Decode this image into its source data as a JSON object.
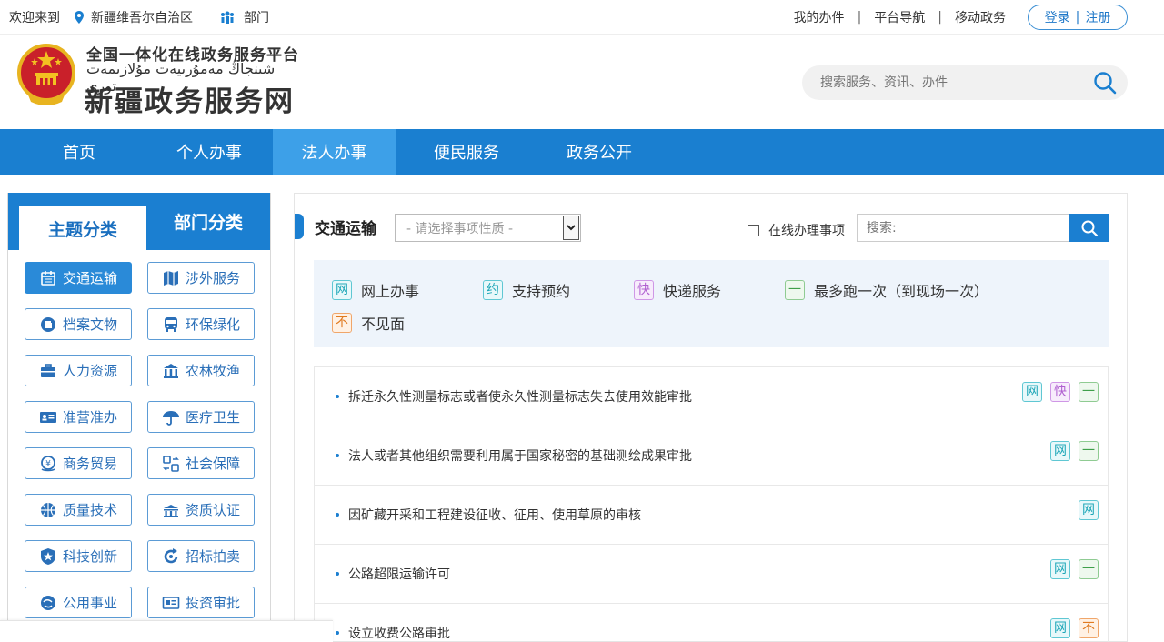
{
  "topbar": {
    "welcome": "欢迎来到",
    "location": "新疆维吾尔自治区",
    "dept": "部门",
    "links": [
      "我的办件",
      "平台导航",
      "移动政务"
    ],
    "login": "登录",
    "register": "注册"
  },
  "header": {
    "line1": "全国一体化在线政务服务平台",
    "line2": "شىنجاڭ مەمۇرىيەت مۇلازىمەت تورى",
    "line3": "新疆政务服务网",
    "search_placeholder": "搜索服务、资讯、办件"
  },
  "nav": {
    "items": [
      "首页",
      "个人办事",
      "法人办事",
      "便民服务",
      "政务公开"
    ],
    "active": "法人办事"
  },
  "sidebar": {
    "tab_theme": "主题分类",
    "tab_dept": "部门分类",
    "categories": [
      {
        "label": "交通运输",
        "icon": "calendar-icon"
      },
      {
        "label": "涉外服务",
        "icon": "map-icon"
      },
      {
        "label": "档案文物",
        "icon": "archive-icon"
      },
      {
        "label": "环保绿化",
        "icon": "bus-icon"
      },
      {
        "label": "人力资源",
        "icon": "briefcase-icon"
      },
      {
        "label": "农林牧渔",
        "icon": "building-icon"
      },
      {
        "label": "准营准办",
        "icon": "id-card-icon"
      },
      {
        "label": "医疗卫生",
        "icon": "umbrella-icon"
      },
      {
        "label": "商务贸易",
        "icon": "trade-icon"
      },
      {
        "label": "社会保障",
        "icon": "swap-icon"
      },
      {
        "label": "质量技术",
        "icon": "ball-icon"
      },
      {
        "label": "资质认证",
        "icon": "bank-icon"
      },
      {
        "label": "科技创新",
        "icon": "shield-star-icon"
      },
      {
        "label": "招标拍卖",
        "icon": "refresh-icon"
      },
      {
        "label": "公用事业",
        "icon": "globe-icon"
      },
      {
        "label": "投资审批",
        "icon": "invest-icon"
      }
    ]
  },
  "panel": {
    "title": "交通运输",
    "select_placeholder": "- 请选择事项性质 -",
    "online_only": "在线办理事项",
    "search_label": "搜索:",
    "legend": [
      {
        "badge": "网",
        "label": "网上办事",
        "type": "net"
      },
      {
        "badge": "约",
        "label": "支持预约",
        "type": "res"
      },
      {
        "badge": "快",
        "label": "快递服务",
        "type": "exp"
      },
      {
        "badge": "一",
        "label": "最多跑一次（到现场一次）",
        "type": "one"
      },
      {
        "badge": "不",
        "label": "不见面",
        "type": "no"
      }
    ],
    "items": [
      {
        "name": "拆迁永久性测量标志或者使永久性测量标志失去使用效能审批",
        "tags": [
          "网",
          "快",
          "一"
        ]
      },
      {
        "name": "法人或者其他组织需要利用属于国家秘密的基础测绘成果审批",
        "tags": [
          "网",
          "一"
        ]
      },
      {
        "name": "因矿藏开采和工程建设征收、征用、使用草原的审核",
        "tags": [
          "网"
        ]
      },
      {
        "name": "公路超限运输许可",
        "tags": [
          "网",
          "一"
        ]
      },
      {
        "name": "设立收费公路审批",
        "tags": [
          "网",
          "不"
        ]
      }
    ]
  },
  "colors": {
    "primary": "#1a7fd0",
    "nav_active": "#3da0e8",
    "legend_bg": "#eef4fb"
  }
}
